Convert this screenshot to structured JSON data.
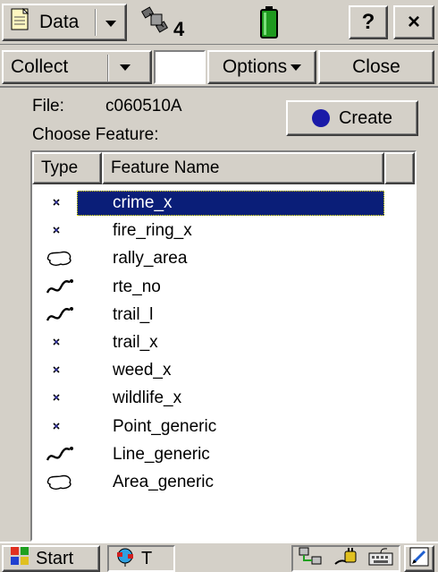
{
  "titlebar": {
    "app_label": "Data",
    "app_icon": "notepad-icon",
    "satellite_count": "4",
    "satellite_icon": "satellite-icon",
    "battery_icon": "battery-icon",
    "help_label": "?",
    "close_label": "×"
  },
  "menubar": {
    "collect_label": "Collect",
    "options_label": "Options",
    "close_label": "Close"
  },
  "form": {
    "file_label": "File:",
    "file_value": "c060510A",
    "choose_label": "Choose Feature:",
    "create_label": "Create"
  },
  "list": {
    "columns": [
      "Type",
      "Feature Name"
    ],
    "selected_index": 0,
    "rows": [
      {
        "type": "point",
        "name": "crime_x"
      },
      {
        "type": "point",
        "name": "fire_ring_x"
      },
      {
        "type": "area",
        "name": "rally_area"
      },
      {
        "type": "line",
        "name": "rte_no"
      },
      {
        "type": "line",
        "name": "trail_l"
      },
      {
        "type": "point",
        "name": "trail_x"
      },
      {
        "type": "point",
        "name": "weed_x"
      },
      {
        "type": "point",
        "name": "wildlife_x"
      },
      {
        "type": "point",
        "name": "Point_generic"
      },
      {
        "type": "line",
        "name": "Line_generic"
      },
      {
        "type": "area",
        "name": "Area_generic"
      }
    ]
  },
  "taskbar": {
    "start_label": "Start",
    "task_label": "T"
  },
  "colors": {
    "selection": "#0a1e78",
    "face": "#d4d0c8",
    "create_dot": "#1a1aa8",
    "battery": "#1f9a1f"
  }
}
